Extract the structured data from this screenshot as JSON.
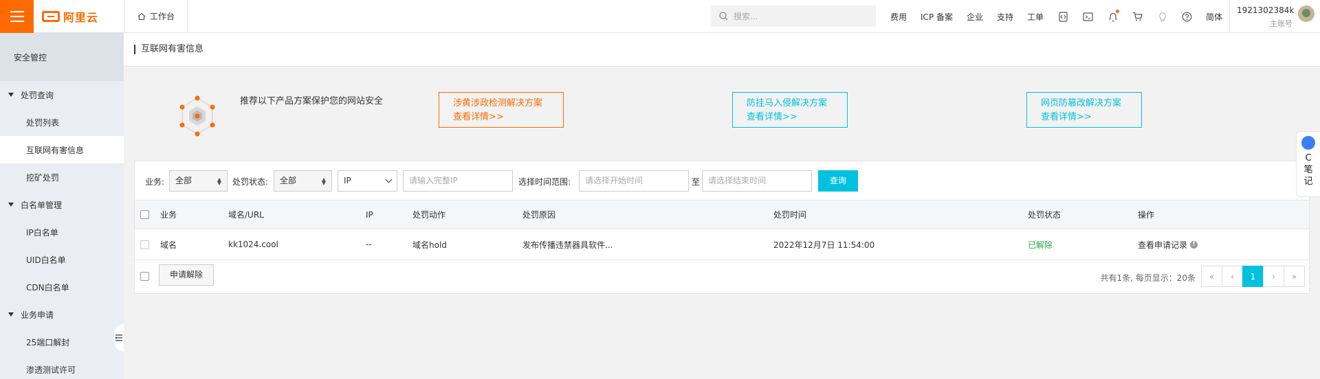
{
  "topbar": {
    "logo_text": "阿里云",
    "workbench_label": "工作台",
    "search_placeholder": "搜索...",
    "links": [
      "费用",
      "ICP 备案",
      "企业",
      "支持",
      "工单"
    ],
    "lang_label": "简体",
    "account_id": "1921302384k",
    "account_role": "主账号",
    "accent_color": "#ff6a00"
  },
  "sidebar": {
    "header": "安全管控",
    "groups": [
      {
        "label": "处罚查询",
        "items": [
          "处罚列表",
          "互联网有害信息",
          "挖矿处罚"
        ]
      },
      {
        "label": "白名单管理",
        "items": [
          "IP白名单",
          "UID白名单",
          "CDN白名单"
        ]
      },
      {
        "label": "业务申请",
        "items": [
          "25端口解封",
          "渗透测试许可"
        ]
      }
    ],
    "active_item": "互联网有害信息"
  },
  "page": {
    "title": "互联网有害信息"
  },
  "promo": {
    "text": "推荐以下产品方案保护您的网站安全",
    "boxes": [
      {
        "title": "涉黄涉政检测解决方案",
        "link": "查看详情>>",
        "color": "#ff6a00"
      },
      {
        "title": "防挂马入侵解决方案",
        "link": "查看详情>>",
        "color": "#00c1de"
      },
      {
        "title": "网页防篡改解决方案",
        "link": "查看详情>>",
        "color": "#00c1de"
      }
    ]
  },
  "filters": {
    "business_label": "业务:",
    "business_value": "全部",
    "status_label": "处罚状态:",
    "status_value": "全部",
    "type_value": "IP",
    "ip_placeholder": "请输入完整IP",
    "time_label": "选择时间范围:",
    "start_placeholder": "请选择开始时间",
    "to_label": "至",
    "end_placeholder": "请选择结束时间",
    "query_button": "查询"
  },
  "table": {
    "columns": [
      "业务",
      "域名/URL",
      "IP",
      "处罚动作",
      "处罚原因",
      "处罚时间",
      "处罚状态",
      "操作"
    ],
    "rows": [
      {
        "business": "域名",
        "domain": "kk1024.cool",
        "ip": "--",
        "action": "域名hold",
        "reason": "发布传播违禁器具软件...",
        "time": "2022年12月7日 11:54:00",
        "status": "已解除",
        "operation": "查看申请记录"
      }
    ],
    "apply_button": "申请解除",
    "page_info": "共有1条, 每页显示：20条",
    "pager": [
      "«",
      "‹",
      "1",
      "›",
      "»"
    ],
    "current_page": "1"
  },
  "float_note": {
    "text": "C笔记"
  }
}
